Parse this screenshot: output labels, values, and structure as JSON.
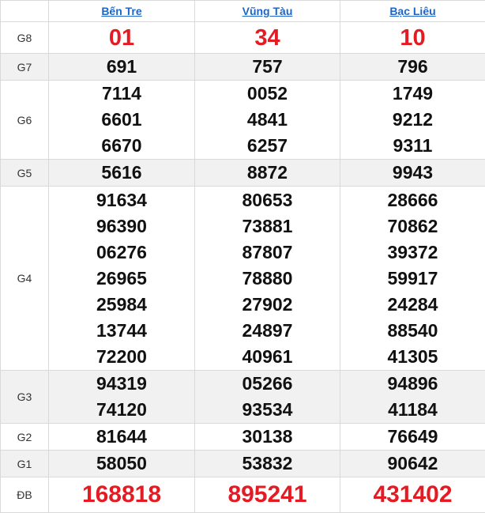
{
  "header": {
    "provinces": [
      "Bến Tre",
      "Vũng Tàu",
      "Bạc Liêu"
    ]
  },
  "colors": {
    "link": "#1e66c8",
    "highlight": "#e41b23",
    "alt_row": "#f1f1f1",
    "border": "#d9d9d9"
  },
  "rows": [
    {
      "label": "G8",
      "values": [
        [
          "01"
        ],
        [
          "34"
        ],
        [
          "10"
        ]
      ]
    },
    {
      "label": "G7",
      "values": [
        [
          "691"
        ],
        [
          "757"
        ],
        [
          "796"
        ]
      ]
    },
    {
      "label": "G6",
      "values": [
        [
          "7114",
          "6601",
          "6670"
        ],
        [
          "0052",
          "4841",
          "6257"
        ],
        [
          "1749",
          "9212",
          "9311"
        ]
      ]
    },
    {
      "label": "G5",
      "values": [
        [
          "5616"
        ],
        [
          "8872"
        ],
        [
          "9943"
        ]
      ]
    },
    {
      "label": "G4",
      "values": [
        [
          "91634",
          "96390",
          "06276",
          "26965",
          "25984",
          "13744",
          "72200"
        ],
        [
          "80653",
          "73881",
          "87807",
          "78880",
          "27902",
          "24897",
          "40961"
        ],
        [
          "28666",
          "70862",
          "39372",
          "59917",
          "24284",
          "88540",
          "41305"
        ]
      ]
    },
    {
      "label": "G3",
      "values": [
        [
          "94319",
          "74120"
        ],
        [
          "05266",
          "93534"
        ],
        [
          "94896",
          "41184"
        ]
      ]
    },
    {
      "label": "G2",
      "values": [
        [
          "81644"
        ],
        [
          "30138"
        ],
        [
          "76649"
        ]
      ]
    },
    {
      "label": "G1",
      "values": [
        [
          "58050"
        ],
        [
          "53832"
        ],
        [
          "90642"
        ]
      ]
    },
    {
      "label": "ĐB",
      "values": [
        [
          "168818"
        ],
        [
          "895241"
        ],
        [
          "431402"
        ]
      ]
    }
  ]
}
